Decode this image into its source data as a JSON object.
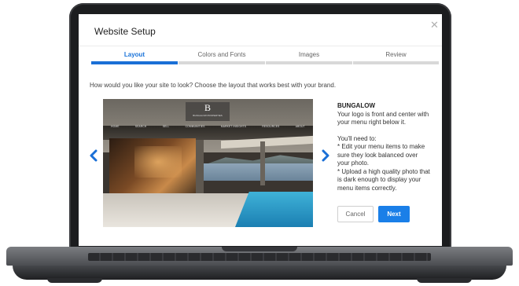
{
  "dialog": {
    "title": "Website Setup",
    "close_icon": "close-icon"
  },
  "tabs": [
    {
      "label": "Layout",
      "active": true
    },
    {
      "label": "Colors and Fonts",
      "active": false
    },
    {
      "label": "Images",
      "active": false
    },
    {
      "label": "Review",
      "active": false
    }
  ],
  "question": "How would you like your site to look?  Choose the layout that works best with your brand.",
  "preview": {
    "logo_letter": "B",
    "logo_sub": "BUNGALOW PROPERTIES",
    "nav_items": [
      "HOME",
      "SEARCH",
      "SELL",
      "COMMUNITIES",
      "MARKET INSIGHTS",
      "RESOURCES",
      "ABOUT"
    ]
  },
  "layout": {
    "name": "BUNGALOW",
    "description": "Your logo is front and center with your menu right below it.",
    "needs_heading": "You'll need to:",
    "need_1": "* Edit your menu items to make sure they look balanced over your photo.",
    "need_2": "* Upload a high quality photo that is dark enough to display your menu items correctly."
  },
  "buttons": {
    "cancel": "Cancel",
    "next": "Next"
  },
  "icons": {
    "prev": "chevron-left-icon",
    "next": "chevron-right-icon"
  },
  "colors": {
    "accent": "#1a7fe8",
    "active_tab": "#1a6fd6",
    "inactive_tab_bar": "#d8d8d8"
  }
}
